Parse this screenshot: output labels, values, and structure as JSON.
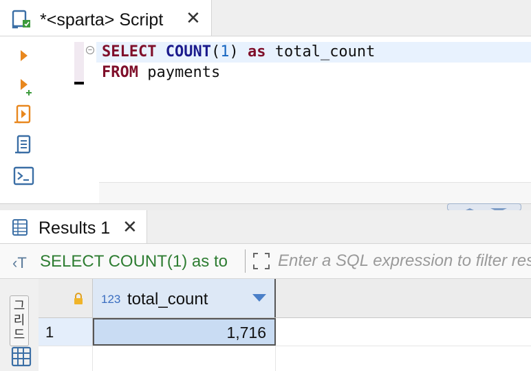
{
  "editor_tab": {
    "title": "*<sparta> Script",
    "close_glyph": "✕",
    "icon": "sql-script-icon"
  },
  "toolbar": {
    "items": [
      {
        "name": "execute-statement-icon"
      },
      {
        "name": "execute-in-new-tab-icon"
      },
      {
        "name": "execute-script-icon"
      },
      {
        "name": "explain-plan-icon"
      },
      {
        "name": "console-icon"
      }
    ]
  },
  "editor": {
    "fold_glyph": "−",
    "line1": {
      "kw1": "SELECT",
      "fn": "COUNT",
      "paren_open": "(",
      "num": "1",
      "paren_close": ")",
      "kw2": "as",
      "ident": "total_count"
    },
    "line2": {
      "kw": "FROM",
      "ident": "payments"
    }
  },
  "results_tab": {
    "title": "Results 1",
    "close_glyph": "✕",
    "icon": "grid-table-icon"
  },
  "filter_bar": {
    "sql_icon_glyph": "‹T",
    "query_text": "SELECT COUNT(1) as to",
    "filter_placeholder": "Enter a SQL expression to filter results (use Ctrl+Space)"
  },
  "side_panel": {
    "vertical_tab_label": "그리드"
  },
  "grid": {
    "columns": [
      {
        "type_badge": "123",
        "name": "total_count"
      }
    ],
    "rows": [
      {
        "row_number": "1",
        "values": [
          "1,716"
        ]
      }
    ]
  },
  "colors": {
    "keyword": "#7f0f2a",
    "function": "#1a1a8c",
    "number": "#1565c0",
    "sql_text": "#2e7d32",
    "selected_cell": "#c9dcf3"
  }
}
